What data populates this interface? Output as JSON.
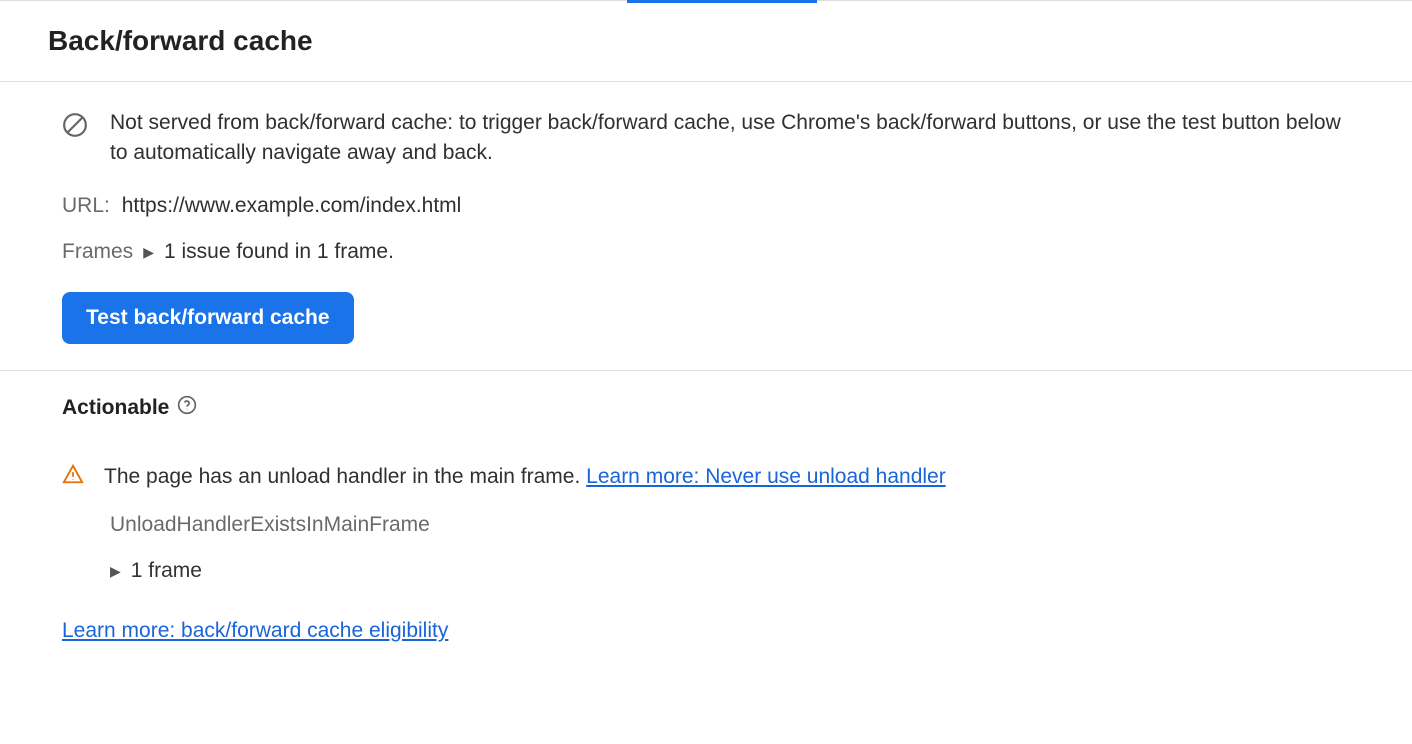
{
  "title": "Back/forward cache",
  "info_message": "Not served from back/forward cache: to trigger back/forward cache, use Chrome's back/forward buttons, or use the test button below to automatically navigate away and back.",
  "url": {
    "label": "URL:",
    "value": "https://www.example.com/index.html"
  },
  "frames": {
    "label": "Frames",
    "summary": "1 issue found in 1 frame."
  },
  "test_button_label": "Test back/forward cache",
  "actionable": {
    "heading": "Actionable",
    "issue_text": "The page has an unload handler in the main frame. ",
    "issue_learn_more": "Learn more: Never use unload handler",
    "reason_code": "UnloadHandlerExistsInMainFrame",
    "frame_summary": "1 frame"
  },
  "footer_link": "Learn more: back/forward cache eligibility"
}
